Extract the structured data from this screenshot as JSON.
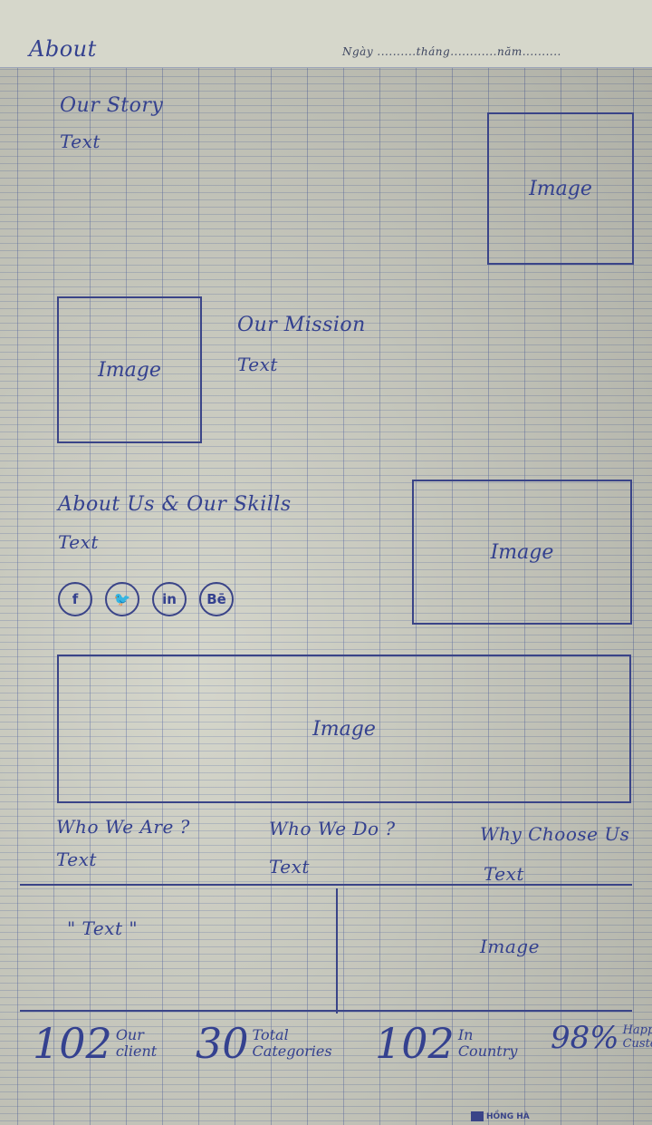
{
  "page": {
    "title": "About",
    "date_line": "Ngày ..........tháng............năm.........."
  },
  "story": {
    "heading": "Our Story",
    "text": "Text",
    "image": "Image"
  },
  "mission": {
    "heading": "Our Mission",
    "text": "Text",
    "image": "Image"
  },
  "about": {
    "heading": "About Us & Our Skills",
    "text": "Text",
    "image": "Image"
  },
  "social": [
    {
      "icon": "facebook-icon",
      "glyph": "f"
    },
    {
      "icon": "twitter-icon",
      "glyph": "🐦"
    },
    {
      "icon": "linkedin-icon",
      "glyph": "in"
    },
    {
      "icon": "behance-icon",
      "glyph": "Bē"
    }
  ],
  "banner": {
    "image": "Image"
  },
  "columns": [
    {
      "heading": "Who We Are ?",
      "text": "Text"
    },
    {
      "heading": "Who We Do ?",
      "text": "Text"
    },
    {
      "heading": "Why Choose Us",
      "text": "Text"
    }
  ],
  "testimonial": {
    "quote": "\" Text \"",
    "image": "Image"
  },
  "stats": [
    {
      "value": "102",
      "label": "Our\nclient"
    },
    {
      "value": "30",
      "label": "Total\nCategories"
    },
    {
      "value": "102",
      "label": "In\nCountry"
    },
    {
      "value": "98%",
      "label": "Happy\nCustomer"
    }
  ],
  "brand": "HỒNG HÀ",
  "colors": {
    "ink": "#34418f",
    "paper": "#d3d4c8"
  }
}
